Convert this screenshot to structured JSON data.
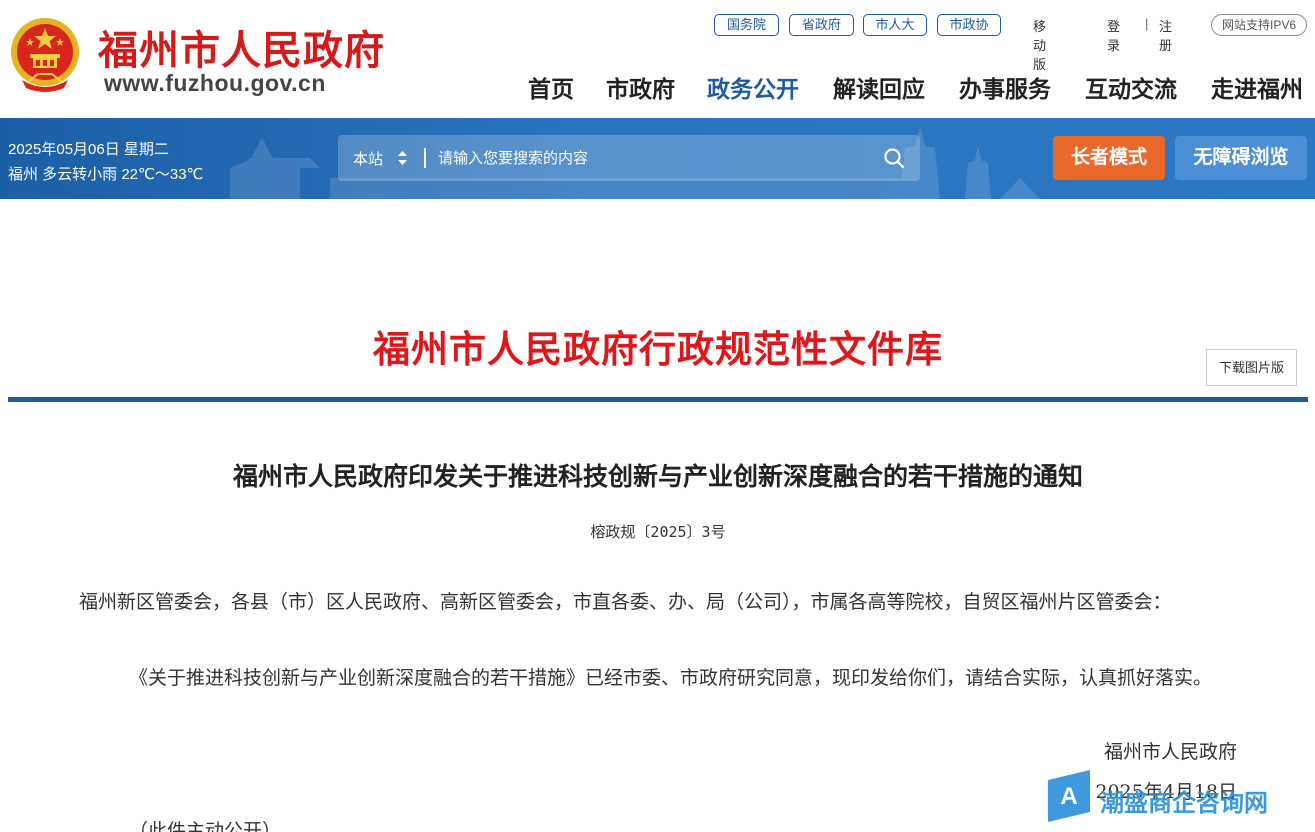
{
  "header": {
    "site_name": "福州市人民政府",
    "site_url": "www.fuzhou.gov.cn",
    "top_links": {
      "guowuyuan": "国务院",
      "shengzhengfu": "省政府",
      "shirenda": "市人大",
      "shizhengxie": "市政协",
      "mobile": "移动版",
      "login": "登录",
      "separator": "|",
      "register": "注册",
      "ipv6": "网站支持IPV6"
    },
    "nav": {
      "home": "首页",
      "gov": "市政府",
      "open": "政务公开",
      "interpret": "解读回应",
      "service": "办事服务",
      "interact": "互动交流",
      "about": "走进福州"
    },
    "active_nav": "政务公开"
  },
  "banner": {
    "date": "2025年05月06日 星期二",
    "weather": "福州 多云转小雨 22℃～33℃",
    "search_scope": "本站",
    "search_scope_arrow": "▴▾",
    "search_placeholder": "请输入您要搜索的内容",
    "elder_mode": "长者模式",
    "accessible": "无障碍浏览"
  },
  "content": {
    "library_title": "福州市人民政府行政规范性文件库",
    "download_image": "下载图片版",
    "doc_title": "福州市人民政府印发关于推进科技创新与产业创新深度融合的若干措施的通知",
    "doc_number": "榕政规〔2025〕3号",
    "para1": "福州新区管委会，各县（市）区人民政府、高新区管委会，市直各委、办、局（公司），市属各高等院校，自贸区福州片区管委会：",
    "para2": "《关于推进科技创新与产业创新深度融合的若干措施》已经市委、市政府研究同意，现印发给你们，请结合实际，认真抓好落实。",
    "sign_org": "福州市人民政府",
    "sign_date": "2025年4月18日",
    "public_note": "（此件主动公开）"
  },
  "watermark": {
    "text": "潮盛商企咨询网"
  },
  "colors": {
    "brand_red": "#d51a1a",
    "brand_blue": "#1d5aa0",
    "elder_orange": "#e8692a",
    "access_blue": "#4d8fd6"
  }
}
